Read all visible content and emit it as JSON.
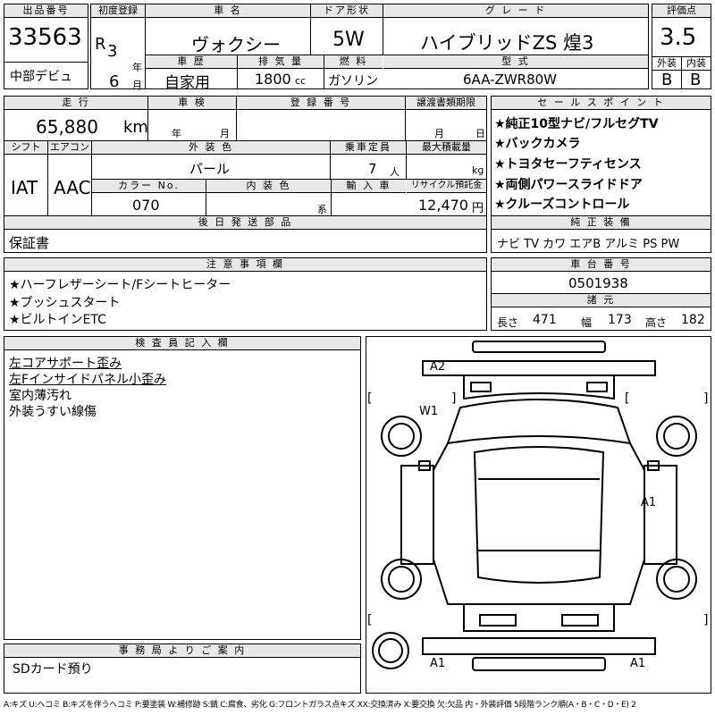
{
  "header": {
    "lot_label": "出品番号",
    "lot_number": "33563",
    "debut": "中部デビュ",
    "reg_label": "初度登録",
    "era": "R",
    "year": "3",
    "year_unit": "年",
    "month": "6",
    "month_unit": "月",
    "name_label": "車 名",
    "car_name": "ヴォクシー",
    "history_label": "車 歴",
    "history": "自家用",
    "disp_label": "排 気 量",
    "displacement": "1800",
    "cc": "cc",
    "door_label": "ドア形状",
    "door": "5W",
    "fuel_label": "燃 料",
    "fuel": "ガソリン",
    "grade_label": "グ レ ー ド",
    "grade": "ハイブリッドZS 煌3",
    "model_label": "型 式",
    "model": "6AA-ZWR80W",
    "score_label": "評価点",
    "score": "3.5",
    "ext_label": "外装",
    "ext": "B",
    "int_label": "内装",
    "int": "B"
  },
  "row2": {
    "mileage_label": "走 行",
    "mileage": "65,880",
    "km": "km",
    "inspection_label": "車 検",
    "insp_year": "年",
    "insp_month": "月",
    "plate_label": "登 録 番 号",
    "transfer_label": "譲渡書類期限",
    "tr_month": "月",
    "tr_day": "日",
    "shift_label": "シフト",
    "shift": "IAT",
    "ac_label": "エアコン",
    "ac": "AAC",
    "color_label": "外 装 色",
    "color": "パール",
    "capacity_label": "乗車定員",
    "capacity": "7",
    "person": "人",
    "load_label": "最大積載量",
    "kg": "kg",
    "colorno_label": "カラー No.",
    "colorno": "070",
    "intcolor_label": "内 装 色",
    "kei": "系",
    "import_label": "輸 入 車",
    "recycle_label": "リサイクル預託金",
    "recycle": "12,470",
    "yen": "円",
    "parts_label": "後 日 発 送 部 品",
    "parts": "保証書"
  },
  "sales": {
    "label": "セ ー ル ス ポ イ ン ト",
    "points": [
      "★純正10型ナビ/フルセグTV",
      "★バックカメラ",
      "★トヨタセーフティセンス",
      "★両側パワースライドドア",
      "★クルーズコントロール"
    ],
    "equip_label": "純 正 装 備",
    "equip": "ナビ TV カワ エアB アルミ PS PW"
  },
  "notes": {
    "label": "注 意 事 項 欄",
    "items": [
      "★ハーフレザーシート/Fシートヒーター",
      "★プッシュスタート",
      "★ビルトインETC"
    ]
  },
  "chassis": {
    "label": "車 台 番 号",
    "number": "0501938",
    "dims_label": "諸 元",
    "len_label": "長さ",
    "len": "471",
    "wid_label": "幅",
    "wid": "173",
    "hgt_label": "高さ",
    "hgt": "182"
  },
  "inspector": {
    "label": "検 査 員 記 入 欄",
    "lines": [
      "左コアサポート歪み",
      "左Fインサイドパネル小歪み",
      "室内薄汚れ",
      "外装うすい線傷"
    ]
  },
  "office": {
    "label": "事 務 局 よ り ご 案 内",
    "text": "SDカード預り"
  },
  "diagram": {
    "marks": [
      "A2",
      "W1",
      "A1",
      "A1",
      "A1"
    ]
  },
  "legend": "A:キズ U:ヘコミ B:キズを伴うヘコミ P:要塗装 W:補修跡 S:錆 C:腐食、劣化 G:フロントガラス点キズ XX:交換済み X:要交換 欠:欠品 内・外装評価 5段階ランク順(A・B・C・D・E) 2"
}
